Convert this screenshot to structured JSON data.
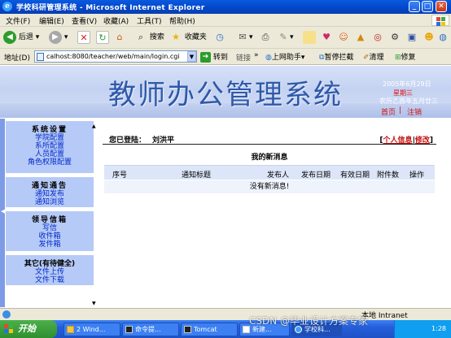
{
  "window": {
    "title": "学校科研管理系统 - Microsoft Internet Explorer"
  },
  "menu": [
    "文件(F)",
    "编辑(E)",
    "查看(V)",
    "收藏(A)",
    "工具(T)",
    "帮助(H)"
  ],
  "toolbar": {
    "back": "后退",
    "search": "搜索",
    "favorites": "收藏夹"
  },
  "address": {
    "label": "地址(D)",
    "url": "calhost:8080/teacher/web/main/login.cgi",
    "go": "转到",
    "links": "链接",
    "online_helper": "上网助手",
    "popup_block": "暂停拦截",
    "clean": "清理",
    "repair": "修复"
  },
  "banner": {
    "app_title": "教师办公管理系统",
    "date": "2005年6月29日",
    "weekday": "星期三",
    "lunar": "农历乙酉年五月廿三",
    "home": "首页",
    "separator": "|",
    "logout": "注销"
  },
  "sidebar": {
    "groups": [
      {
        "title": "系统设置",
        "items": [
          "学院配置",
          "系所配置",
          "人员配置",
          "角色权限配置"
        ]
      },
      {
        "title": "通知通告",
        "items": [
          "通知发布",
          "通知浏览"
        ]
      },
      {
        "title": "领导信箱",
        "items": [
          "写信",
          "收件箱",
          "发件箱"
        ]
      },
      {
        "title": "其它(有待健全)",
        "items": [
          "文件上传",
          "文件下载"
        ]
      }
    ]
  },
  "main": {
    "logged_in_label": "您已登陆：",
    "user_name": "刘洪平",
    "bracket_open": "[",
    "personal_info": "个人信息",
    "pipe": "|",
    "modify": "修改",
    "bracket_close": "]",
    "section_title": "我的新消息",
    "columns": [
      "序号",
      "通知标题",
      "发布人",
      "发布日期",
      "有效日期",
      "附件数",
      "操作"
    ],
    "empty_message": "没有新消息!"
  },
  "statusbar": {
    "zone": "本地 Intranet"
  },
  "taskbar": {
    "start": "开始",
    "tasks": [
      "2 Wind...",
      "命令提...",
      "Tomcat",
      "新建...",
      "学校科..."
    ],
    "clock": "1:28"
  },
  "watermark": "CSDN @毕业设计方案专家"
}
